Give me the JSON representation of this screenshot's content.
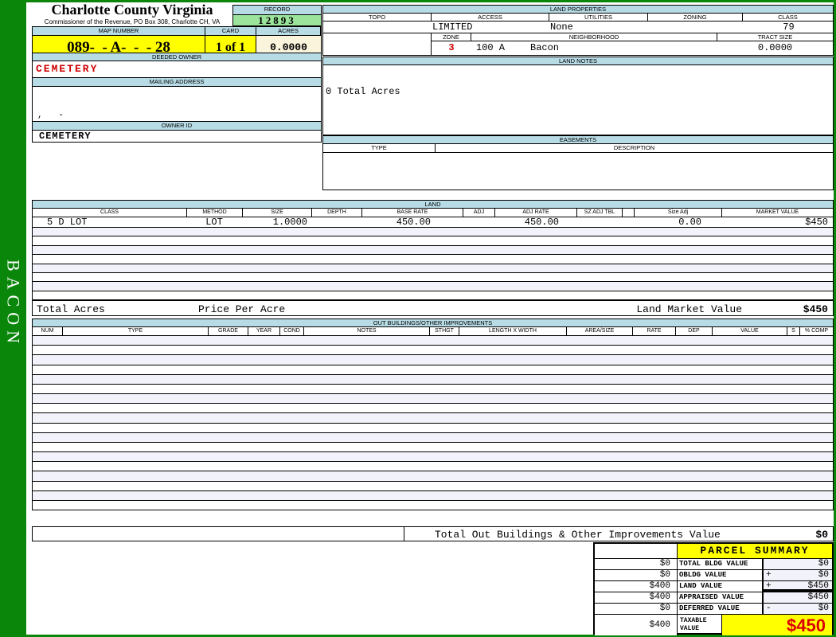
{
  "colors": {
    "frame_green": "#0a860a",
    "header_blue": "#b8dce6",
    "highlight_yellow": "#ffff00",
    "record_green": "#9ce49c",
    "acres_cream": "#faf4dc",
    "stripe_lavender": "#f2f2fa",
    "alert_red": "#cc0000",
    "taxable_red": "#dd0000"
  },
  "sidebar": {
    "label": "BACON"
  },
  "header": {
    "title": "Charlotte County Virginia",
    "subtitle": "Commissioner of the Revenue, PO Box 308, Charlotte CH, VA",
    "record_label": "RECORD",
    "record_value": "12893",
    "map_number_label": "MAP NUMBER",
    "map_number_value": "089-  - A-  -  - 28",
    "card_label": "CARD",
    "card_value": "1 of 1",
    "acres_label": "ACRES",
    "acres_value": "0.0000"
  },
  "owner": {
    "deeded_owner_label": "DEEDED OWNER",
    "deeded_owner_value": "CEMETERY",
    "mailing_address_label": "MAILING ADDRESS",
    "mailing_address_value": ",   -",
    "owner_id_label": "OWNER ID",
    "owner_id_value": "CEMETERY"
  },
  "land_properties": {
    "title": "LAND PROPERTIES",
    "columns": [
      "TOPO",
      "ACCESS",
      "UTILITIES",
      "ZONING",
      "CLASS"
    ],
    "topo_value": "",
    "access_value": "LIMITED",
    "utilities_value": "None",
    "zoning_value": "",
    "class_value": "79",
    "zone_label": "ZONE",
    "zone_value": "3",
    "neighborhood_label": "NEIGHBORHOOD",
    "neighborhood_code": "100 A",
    "neighborhood_name": "Bacon",
    "tract_size_label": "TRACT SIZE",
    "tract_size_value": "0.0000"
  },
  "land_notes": {
    "title": "LAND NOTES",
    "text": "0 Total Acres"
  },
  "easements": {
    "title": "EASEMENTS",
    "type_label": "TYPE",
    "description_label": "DESCRIPTION"
  },
  "land": {
    "title": "LAND",
    "columns": [
      "CLASS",
      "METHOD",
      "SIZE",
      "DEPTH",
      "BASE RATE",
      "ADJ",
      "ADJ RATE",
      "SZ ADJ TBL",
      "",
      "Size Adj",
      "MARKET VALUE"
    ],
    "row": {
      "class": "5 D LOT",
      "method": "LOT",
      "size": "1.0000",
      "depth": "",
      "base_rate": "450.00",
      "adj": "",
      "adj_rate": "450.00",
      "sz_adj_tbl": "",
      "size_adj": "0.00",
      "market_value": "$450"
    },
    "empty_row_count": 8,
    "total_acres_label": "Total Acres",
    "price_per_acre_label": "Price Per Acre",
    "land_market_value_label": "Land Market Value",
    "land_market_value_total": "$450"
  },
  "out_buildings": {
    "title": "OUT BUILDINGS/OTHER IMPROVEMENTS",
    "columns": [
      "NUM",
      "TYPE",
      "GRADE",
      "YEAR",
      "COND",
      "NOTES",
      "STHGT",
      "LENGTH X WIDTH",
      "AREA/SIZE",
      "RATE",
      "DEP",
      "VALUE",
      "S",
      "% COMP"
    ],
    "empty_row_count": 18,
    "total_label": "Total Out Buildings & Other Improvements Value",
    "total_value": "$0"
  },
  "parcel_summary": {
    "title": "PARCEL SUMMARY",
    "rows": [
      {
        "left": "$0",
        "label": "TOTAL BLDG VALUE",
        "op": "",
        "value": "$0"
      },
      {
        "left": "$0",
        "label": "OBLDG VALUE",
        "op": "+",
        "value": "$0"
      },
      {
        "left": "$400",
        "label": "LAND VALUE",
        "op": "+",
        "value": "$450"
      },
      {
        "left": "$400",
        "label": "APPRAISED VALUE",
        "op": "",
        "value": "$450"
      },
      {
        "left": "$0",
        "label": "DEFERRED VALUE",
        "op": "-",
        "value": "$0"
      }
    ],
    "taxable": {
      "left": "$400",
      "label": "TAXABLE VALUE",
      "value": "$450"
    }
  }
}
